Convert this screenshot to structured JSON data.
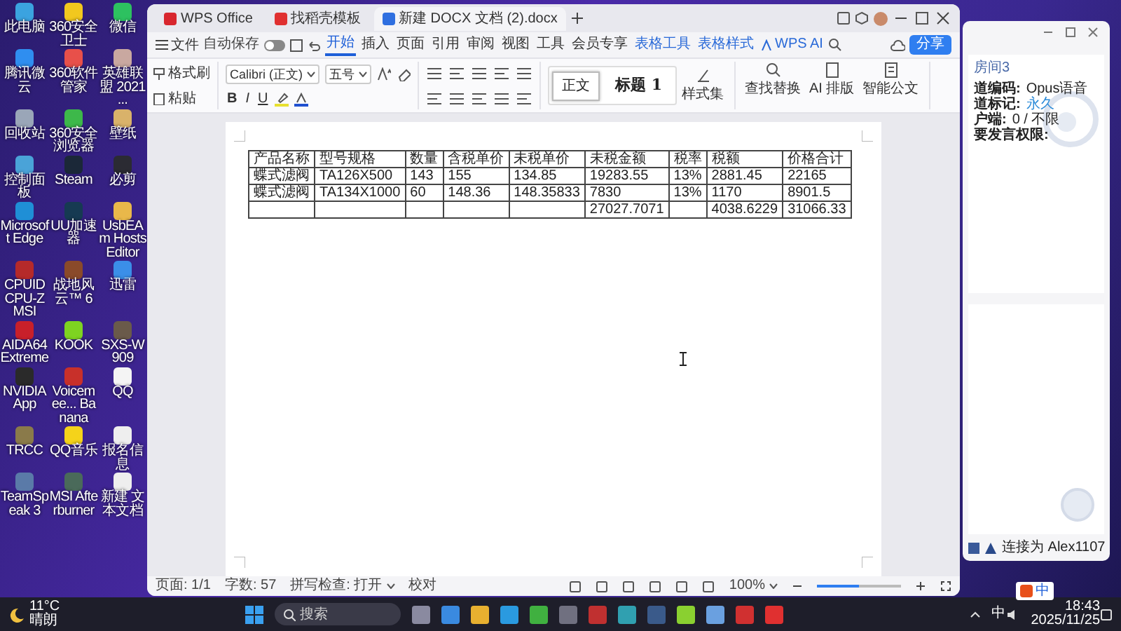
{
  "desktop_icons": [
    {
      "label": "此电脑",
      "color": "#3ba3e0"
    },
    {
      "label": "360安全卫士",
      "color": "#f2c81e"
    },
    {
      "label": "微信",
      "color": "#2dc160"
    },
    {
      "label": "腾讯微云",
      "color": "#2f8ef0"
    },
    {
      "label": "360软件管家",
      "color": "#e8504a"
    },
    {
      "label": "英雄联盟 2021 ...",
      "color": "#c9a8a0"
    },
    {
      "label": "回收站",
      "color": "#9aa6b8"
    },
    {
      "label": "360安全浏览器",
      "color": "#3db84a"
    },
    {
      "label": "壁纸",
      "color": "#d9b26a"
    },
    {
      "label": "控制面板",
      "color": "#4aa3d8"
    },
    {
      "label": "Steam",
      "color": "#1b2838"
    },
    {
      "label": "必剪",
      "color": "#2b2b33"
    },
    {
      "label": "Microsoft Edge",
      "color": "#1f8fd6"
    },
    {
      "label": "UU加速器",
      "color": "#163a52"
    },
    {
      "label": "UsbEAm Hosts Editor",
      "color": "#e9b84a"
    },
    {
      "label": "CPUID CPU-Z MSI",
      "color": "#b52a2a"
    },
    {
      "label": "战地风云™ 6",
      "color": "#8a4a2a"
    },
    {
      "label": "迅雷",
      "color": "#3b8fe8"
    },
    {
      "label": "AIDA64 Extreme",
      "color": "#c8202a"
    },
    {
      "label": "KOOK",
      "color": "#7ed321"
    },
    {
      "label": "SXS-W909",
      "color": "#6a5a4a"
    },
    {
      "label": "NVIDIA App",
      "color": "#2a2a2a"
    },
    {
      "label": "Voicemee... Banana",
      "color": "#c8302a"
    },
    {
      "label": "QQ",
      "color": "#f4f4f4"
    },
    {
      "label": "TRCC",
      "color": "#8a7a4a"
    },
    {
      "label": "QQ音乐",
      "color": "#f5d31a"
    },
    {
      "label": "报名信息",
      "color": "#eeeeee"
    },
    {
      "label": "TeamSpeak 3",
      "color": "#5a7aa8"
    },
    {
      "label": "MSI Afterburner",
      "color": "#4a6a5a"
    },
    {
      "label": "新建 文本文档",
      "color": "#eeeeee"
    }
  ],
  "wps": {
    "tabs": [
      {
        "label": "WPS Office",
        "selected": false,
        "kind": "home"
      },
      {
        "label": "找稻壳模板",
        "selected": false,
        "kind": "template"
      },
      {
        "label": "新建 DOCX 文档 (2).docx",
        "selected": true,
        "kind": "doc"
      }
    ],
    "menu": {
      "file": "文件",
      "autosave": {
        "label": "自动保存",
        "on": false
      },
      "tabs": [
        {
          "label": "开始",
          "selected": true,
          "kind": "plain"
        },
        {
          "label": "插入",
          "selected": false,
          "kind": "plain"
        },
        {
          "label": "页面",
          "selected": false,
          "kind": "plain"
        },
        {
          "label": "引用",
          "selected": false,
          "kind": "plain"
        },
        {
          "label": "审阅",
          "selected": false,
          "kind": "plain"
        },
        {
          "label": "视图",
          "selected": false,
          "kind": "plain"
        },
        {
          "label": "工具",
          "selected": false,
          "kind": "plain"
        },
        {
          "label": "会员专享",
          "selected": false,
          "kind": "plain"
        },
        {
          "label": "表格工具",
          "selected": false,
          "kind": "context"
        },
        {
          "label": "表格样式",
          "selected": false,
          "kind": "context"
        },
        {
          "label": "WPS AI",
          "selected": false,
          "kind": "ai"
        }
      ],
      "share": "分享"
    },
    "ribbon": {
      "format_painter": "格式刷",
      "paste": "粘贴",
      "font": "Calibri (正文)",
      "size": "五号",
      "format_buttons": [
        {
          "label": "B",
          "kind": "bold"
        },
        {
          "label": "I",
          "kind": "italic"
        },
        {
          "label": "U",
          "kind": "underline"
        }
      ],
      "styles": [
        {
          "label": "正文",
          "selected": true
        },
        {
          "label": "标题 1",
          "selected": false
        }
      ],
      "style_set": "样式集",
      "find_replace": "查找替换",
      "ai_layout": "AI 排版",
      "smart_doc": "智能公文"
    },
    "table": {
      "columns": [
        "产品名称",
        "型号规格",
        "数量",
        "含税单价",
        "未税单价",
        "未税金额",
        "税率",
        "税额",
        "价格合计"
      ],
      "rows": [
        [
          "蝶式滤阀",
          "TA126X500",
          "143",
          "155",
          "134.85",
          "19283.55",
          "13%",
          "2881.45",
          "22165"
        ],
        [
          "蝶式滤阀",
          "TA134X1000",
          "60",
          "148.36",
          "148.35833",
          "7830",
          "13%",
          "1170",
          "8901.5"
        ],
        [
          null,
          null,
          null,
          null,
          null,
          "27027.7071",
          null,
          "4038.6229",
          "31066.33"
        ]
      ]
    },
    "status_bar": {
      "page": "页面: 1/1",
      "words": "字数: 57",
      "spell": "拼写检查: 打开",
      "proofread": "校对",
      "zoom": "100%",
      "zoom_slider": {
        "level": 0.5
      }
    }
  },
  "side_window": {
    "title": "房间3",
    "info": [
      {
        "label": "道编码:",
        "value": "Opus语音",
        "kind": "plain"
      },
      {
        "label": "道标记:",
        "value": "永久",
        "kind": "link"
      },
      {
        "label": "户端:",
        "value": "0 / 不限",
        "kind": "plain"
      },
      {
        "label": "要发言权限:",
        "kind": "plain"
      }
    ],
    "status": "连接为 Alex1107"
  },
  "taskbar": {
    "temperature": "11°C",
    "weather": "晴朗",
    "search_placeholder": "搜索",
    "ime_bar": "中",
    "ime": "中",
    "time": "18:43",
    "date": "2025/11/25"
  }
}
